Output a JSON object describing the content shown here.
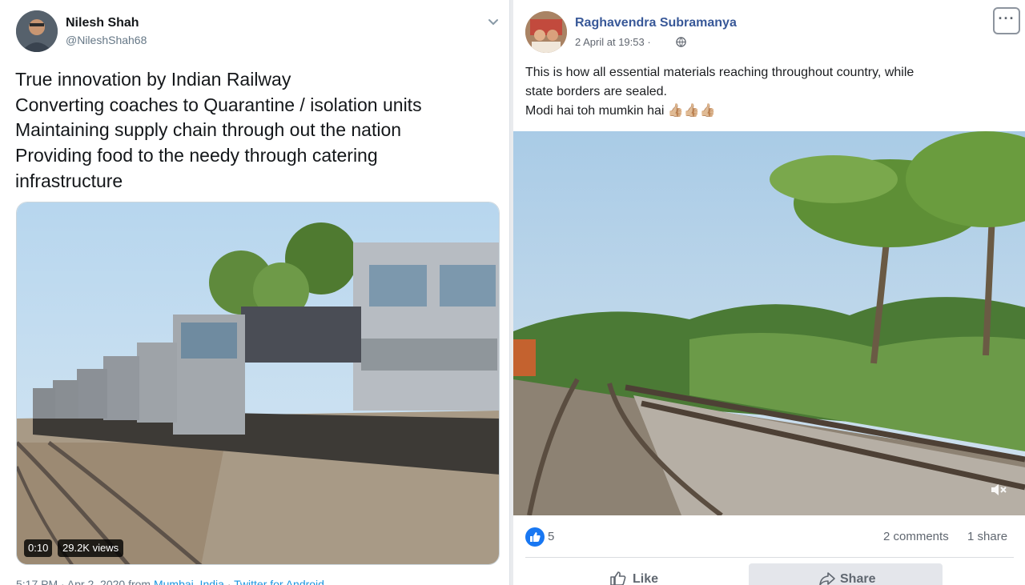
{
  "tweet": {
    "author_name": "Nilesh Shah",
    "author_handle": "@NileshShah68",
    "text_lines": [
      "True innovation by Indian Railway",
      "Converting coaches to Quarantine / isolation units",
      "Maintaining supply chain through out the nation",
      "Providing food to the needy through catering",
      "infrastructure"
    ],
    "video_duration": "0:10",
    "video_views": "29.2K views",
    "meta_time": "5:17 PM · Apr 2, 2020 from",
    "meta_location": "Mumbai, India",
    "meta_sep": "·",
    "meta_source": "Twitter for Android"
  },
  "facebook_post": {
    "author_name": "Raghavendra Subramanya",
    "date": "2 April at 19:53 ·",
    "more_label": "···",
    "text_lines": [
      "This is how all essential materials reaching throughout country, while",
      "state borders are sealed.",
      "Modi hai toh mumkin hai 👍🏼👍🏼👍🏼"
    ],
    "like_count": "5",
    "comments": "2 comments",
    "shares": "1 share",
    "like_button": "Like",
    "share_button": "Share"
  },
  "icons": {
    "tweet_menu": "chevron-down-icon",
    "privacy": "globe-icon",
    "mute": "speaker-muted-icon",
    "reaction": "thumbs-up-icon",
    "like": "thumbs-up-outline-icon",
    "share": "share-arrow-icon"
  },
  "colors": {
    "twitter_link": "#1b95e0",
    "facebook_name": "#385898",
    "facebook_like_blue": "#1877f2"
  }
}
